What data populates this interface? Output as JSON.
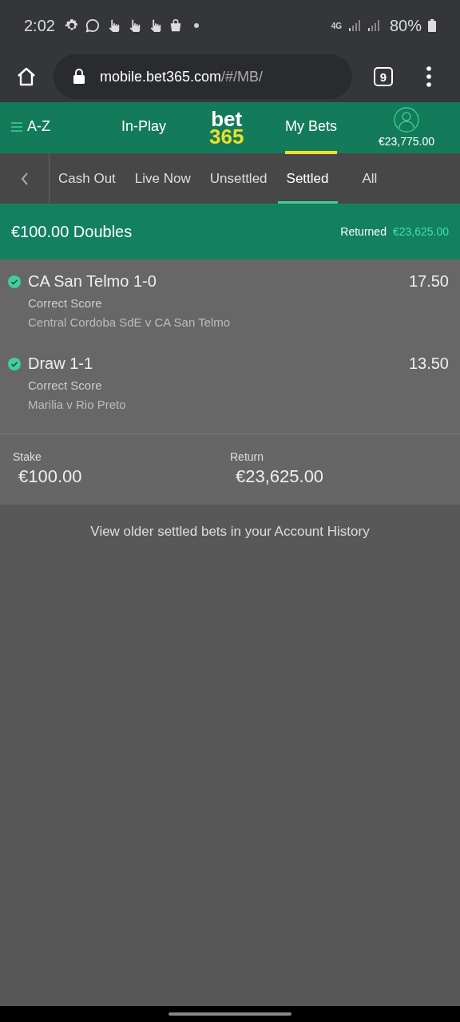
{
  "status_bar": {
    "time": "2:02",
    "network": "4G",
    "battery": "80%"
  },
  "browser": {
    "url_host": "mobile.bet365.com",
    "url_path": "/#/MB/",
    "tab_count": "9"
  },
  "header": {
    "menu_label": "A-Z",
    "logo": [
      "bet",
      "365"
    ],
    "balance": "€23,775.00",
    "nav": [
      {
        "label": "In-Play",
        "selected": false
      },
      {
        "label": "My Bets",
        "selected": true
      }
    ]
  },
  "tabs": [
    {
      "label": "Cash Out",
      "selected": false
    },
    {
      "label": "Live Now",
      "selected": false
    },
    {
      "label": "Unsettled",
      "selected": false
    },
    {
      "label": "Settled",
      "selected": true
    },
    {
      "label": "All",
      "selected": false
    }
  ],
  "bet": {
    "title": "€100.00 Doubles",
    "returned_label": "Returned",
    "returned_value": "€23,625.00",
    "selections": [
      {
        "name": "CA San Telmo 1-0",
        "odds": "17.50",
        "market": "Correct Score",
        "event": "Central Cordoba SdE v CA San Telmo",
        "won": true
      },
      {
        "name": "Draw 1-1",
        "odds": "13.50",
        "market": "Correct Score",
        "event": "Marilia v Rio Preto",
        "won": true
      }
    ],
    "stake_label": "Stake",
    "stake": "€100.00",
    "return_label": "Return",
    "return": "€23,625.00"
  },
  "footer_link": "View older settled bets in your Account History"
}
